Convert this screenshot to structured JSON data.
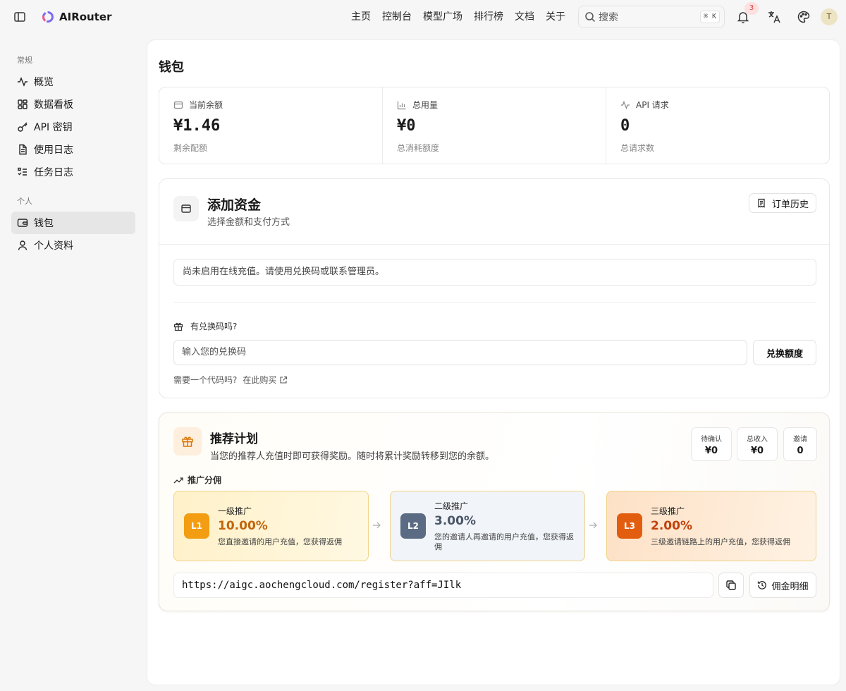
{
  "header": {
    "brand": "AIRouter",
    "nav": [
      "主页",
      "控制台",
      "模型广场",
      "排行榜",
      "文档",
      "关于"
    ],
    "search_placeholder": "搜索",
    "search_shortcut": "⌘ K",
    "notifications_count": "3",
    "avatar_initial": "T"
  },
  "sidebar": {
    "groups": [
      {
        "label": "常规",
        "items": [
          {
            "label": "概览",
            "icon": "activity-icon"
          },
          {
            "label": "数据看板",
            "icon": "dashboard-icon"
          },
          {
            "label": "API 密钥",
            "icon": "key-icon"
          },
          {
            "label": "使用日志",
            "icon": "file-icon"
          },
          {
            "label": "任务日志",
            "icon": "list-icon"
          }
        ]
      },
      {
        "label": "个人",
        "items": [
          {
            "label": "钱包",
            "icon": "wallet-icon",
            "active": true
          },
          {
            "label": "个人资料",
            "icon": "user-icon"
          }
        ]
      }
    ]
  },
  "page": {
    "title": "钱包"
  },
  "stats": [
    {
      "label": "当前余额",
      "value": "¥1.46",
      "sub": "剩余配额"
    },
    {
      "label": "总用量",
      "value": "¥0",
      "sub": "总消耗额度"
    },
    {
      "label": "API 请求",
      "value": "0",
      "sub": "总请求数"
    }
  ],
  "funds": {
    "title": "添加资金",
    "subtitle": "选择金额和支付方式",
    "history_button": "订单历史",
    "notice": "尚未启用在线充值。请使用兑换码或联系管理员。",
    "redeem_label": "有兑换码吗?",
    "redeem_placeholder": "输入您的兑换码",
    "redeem_button": "兑换额度",
    "need_code": "需要一个代码吗?",
    "buy_link": "在此购买"
  },
  "referral": {
    "title": "推荐计划",
    "subtitle": "当您的推荐人充值时即可获得奖励。随时将累计奖励转移到您的余额。",
    "pending_label": "待确认",
    "pending_value": "¥0",
    "income_label": "总收入",
    "income_value": "¥0",
    "invites_label": "邀请",
    "invites_value": "0",
    "tiers_heading": "推广分佣",
    "tiers": [
      {
        "badge": "L1",
        "name": "一级推广",
        "percent": "10.00%",
        "desc": "您直接邀请的用户充值，您获得返佣",
        "color": "#f29d12"
      },
      {
        "badge": "L2",
        "name": "二级推广",
        "percent": "3.00%",
        "desc": "您的邀请人再邀请的用户充值，您获得返佣",
        "color": "#5b6b84"
      },
      {
        "badge": "L3",
        "name": "三级推广",
        "percent": "2.00%",
        "desc": "三级邀请链路上的用户充值，您获得返佣",
        "color": "#e35d0f"
      }
    ],
    "link": "https://aigc.aochengcloud.com/register?aff=JIlk",
    "commission_button": "佣金明细"
  },
  "colors": {
    "tier1_text": "#c2650a",
    "tier2_text": "#4a5568",
    "tier3_text": "#c2410c"
  }
}
